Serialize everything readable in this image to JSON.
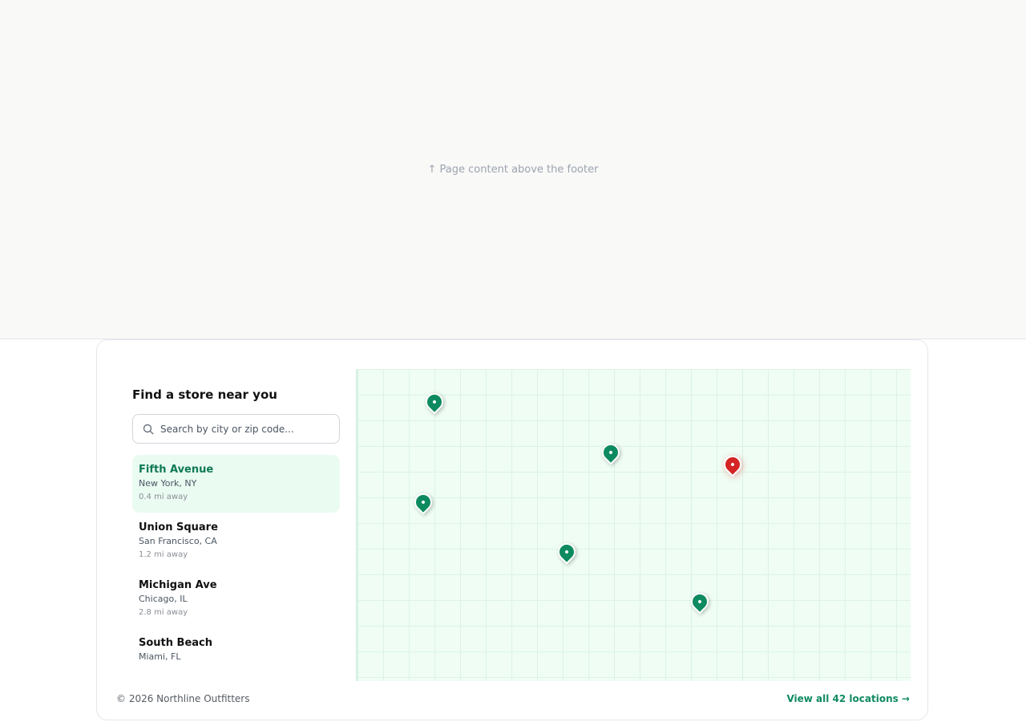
{
  "page_content": {
    "note": "↑ Page content above the footer"
  },
  "store_finder": {
    "title": "Find a store near you",
    "search": {
      "placeholder": "Search by city or zip code...",
      "value": "",
      "icon": "search-icon"
    },
    "stores": [
      {
        "name": "Fifth Avenue",
        "city": "New York, NY",
        "distance": "0.4 mi away",
        "active": true
      },
      {
        "name": "Union Square",
        "city": "San Francisco, CA",
        "distance": "1.2 mi away",
        "active": false
      },
      {
        "name": "Michigan Ave",
        "city": "Chicago, IL",
        "distance": "2.8 mi away",
        "active": false
      },
      {
        "name": "South Beach",
        "city": "Miami, FL",
        "distance": "",
        "active": false
      }
    ],
    "map": {
      "pins": [
        {
          "kind": "store",
          "color": "#0d8a5f"
        },
        {
          "kind": "store",
          "color": "#0d8a5f"
        },
        {
          "kind": "selected",
          "color": "#d42424"
        },
        {
          "kind": "store",
          "color": "#0d8a5f"
        },
        {
          "kind": "store",
          "color": "#0d8a5f"
        },
        {
          "kind": "store",
          "color": "#0d8a5f"
        }
      ]
    }
  },
  "footer": {
    "copyright": "© 2026 Northline Outfitters",
    "view_all_label": "View all 42 locations →"
  },
  "colors": {
    "accent": "#0f8a5f",
    "selected_pin": "#d42424",
    "active_item_bg": "#eafbf2",
    "map_bg": "#effdf4"
  }
}
